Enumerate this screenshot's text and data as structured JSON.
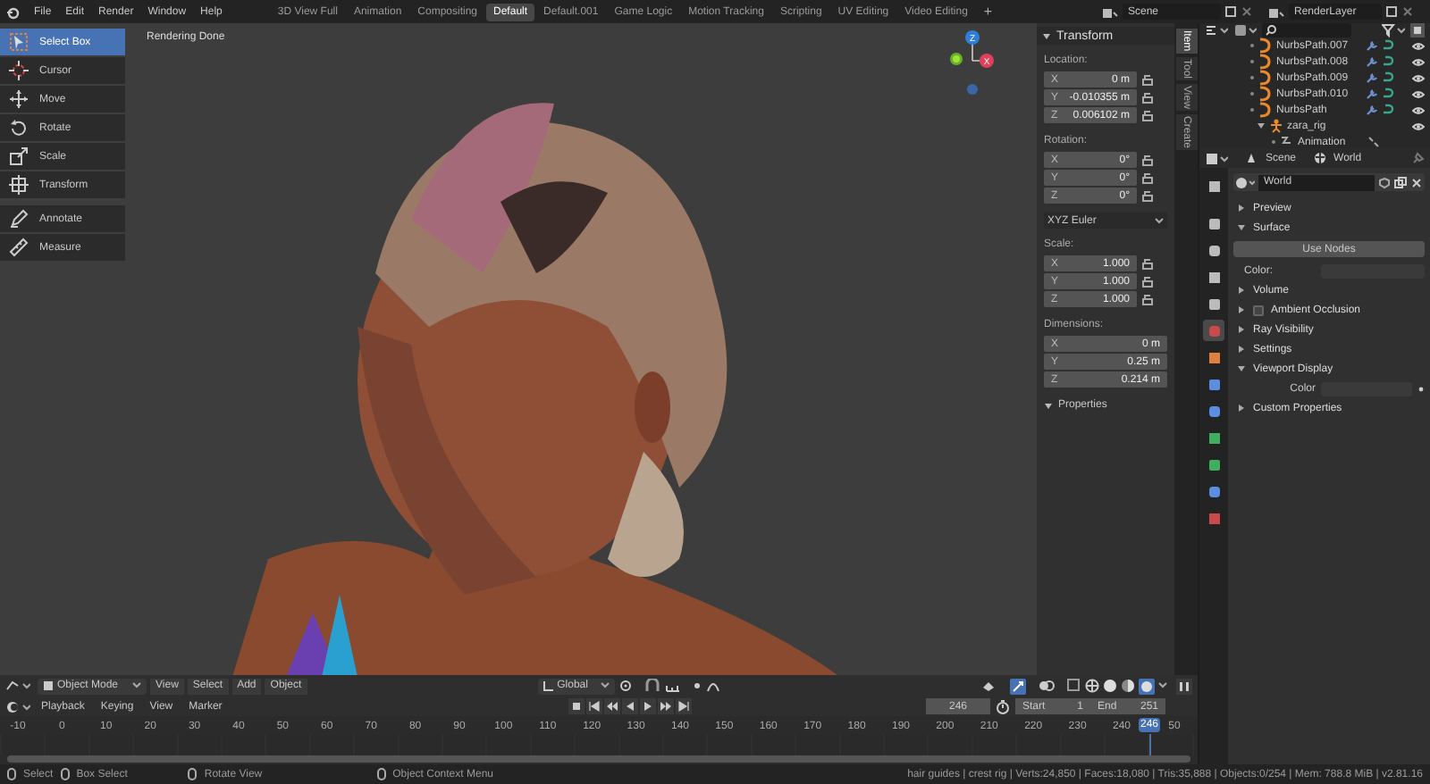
{
  "menu": [
    "File",
    "Edit",
    "Render",
    "Window",
    "Help"
  ],
  "workspaces": [
    {
      "label": "3D View Full",
      "selected": false
    },
    {
      "label": "Animation",
      "selected": false
    },
    {
      "label": "Compositing",
      "selected": false
    },
    {
      "label": "Default",
      "selected": true
    },
    {
      "label": "Default.001",
      "selected": false
    },
    {
      "label": "Game Logic",
      "selected": false
    },
    {
      "label": "Motion Tracking",
      "selected": false
    },
    {
      "label": "Scripting",
      "selected": false
    },
    {
      "label": "UV Editing",
      "selected": false
    },
    {
      "label": "Video Editing",
      "selected": false
    }
  ],
  "add_workspace": "+",
  "scene": "Scene",
  "view_layer": "RenderLayer",
  "tools": [
    {
      "label": "Select Box",
      "selected": true
    },
    {
      "label": "Cursor",
      "selected": false
    },
    {
      "label": "Move",
      "selected": false
    },
    {
      "label": "Rotate",
      "selected": false
    },
    {
      "label": "Scale",
      "selected": false
    },
    {
      "label": "Transform",
      "selected": false
    },
    {
      "label": "Annotate",
      "selected": false
    },
    {
      "label": "Measure",
      "selected": false
    }
  ],
  "viewport_message": "Rendering Done",
  "gizmo": {
    "z": "Z",
    "x": "X"
  },
  "sidebar_tabs": [
    {
      "label": "Item",
      "selected": true
    },
    {
      "label": "Tool",
      "selected": false
    },
    {
      "label": "View",
      "selected": false
    },
    {
      "label": "Create",
      "selected": false
    }
  ],
  "transform": {
    "title": "Transform",
    "groups": [
      {
        "label": "Location:",
        "locks": true,
        "fields": [
          {
            "axis": "X",
            "value": "0 m"
          },
          {
            "axis": "Y",
            "value": "-0.010355 m"
          },
          {
            "axis": "Z",
            "value": "0.006102 m"
          }
        ]
      },
      {
        "label": "Rotation:",
        "locks": true,
        "fields": [
          {
            "axis": "X",
            "value": "0°"
          },
          {
            "axis": "Y",
            "value": "0°"
          },
          {
            "axis": "Z",
            "value": "0°"
          }
        ]
      },
      {
        "label": "Scale:",
        "locks": true,
        "fields": [
          {
            "axis": "X",
            "value": "1.000"
          },
          {
            "axis": "Y",
            "value": "1.000"
          },
          {
            "axis": "Z",
            "value": "1.000"
          }
        ]
      },
      {
        "label": "Dimensions:",
        "locks": false,
        "fields": [
          {
            "axis": "X",
            "value": "0 m"
          },
          {
            "axis": "Y",
            "value": "0.25 m"
          },
          {
            "axis": "Z",
            "value": "0.214 m"
          }
        ]
      }
    ],
    "rotation_mode": "XYZ Euler",
    "properties_panel": "Properties"
  },
  "header_3d": {
    "mode": "Object Mode",
    "menus": [
      "View",
      "Select",
      "Add",
      "Object"
    ],
    "orientation": "Global"
  },
  "outliner": {
    "items": [
      {
        "name": "NurbsPath.007",
        "kind": "curve"
      },
      {
        "name": "NurbsPath.008",
        "kind": "curve"
      },
      {
        "name": "NurbsPath.009",
        "kind": "curve"
      },
      {
        "name": "NurbsPath.010",
        "kind": "curve"
      },
      {
        "name": "NurbsPath",
        "kind": "curve"
      },
      {
        "name": "zara_rig",
        "kind": "armature",
        "expanded": true,
        "children": [
          {
            "name": "Animation",
            "kind": "action"
          }
        ]
      }
    ]
  },
  "properties": {
    "path": [
      "Scene",
      "World"
    ],
    "datablock": "World",
    "tabs": [
      {
        "selected": false
      },
      {
        "selected": false
      },
      {
        "selected": false
      },
      {
        "selected": false
      },
      {
        "selected": false
      },
      {
        "selected": true
      },
      {
        "selected": false
      },
      {
        "selected": false
      },
      {
        "selected": false
      },
      {
        "selected": false
      },
      {
        "selected": false
      },
      {
        "selected": false
      },
      {
        "selected": false
      }
    ],
    "rows": [
      {
        "kind": "panel",
        "label": "Preview",
        "expanded": false
      },
      {
        "kind": "panel",
        "label": "Surface",
        "expanded": true
      },
      {
        "kind": "button",
        "label": "Use Nodes"
      },
      {
        "kind": "color",
        "label": "Color:"
      },
      {
        "kind": "panel",
        "label": "Volume",
        "expanded": false
      },
      {
        "kind": "check_panel",
        "label": "Ambient Occlusion",
        "checked": false
      },
      {
        "kind": "panel",
        "label": "Ray Visibility",
        "expanded": false
      },
      {
        "kind": "panel",
        "label": "Settings",
        "expanded": false
      },
      {
        "kind": "panel",
        "label": "Viewport Display",
        "expanded": true
      },
      {
        "kind": "color",
        "label": "Color"
      },
      {
        "kind": "panel",
        "label": "Custom Properties",
        "expanded": false
      }
    ]
  },
  "timeline": {
    "menus": [
      "Playback",
      "Keying",
      "View",
      "Marker"
    ],
    "current_frame": "246",
    "start_label": "Start",
    "start": "1",
    "end_label": "End",
    "end": "251",
    "ticks": [
      "-10",
      "0",
      "10",
      "20",
      "30",
      "40",
      "50",
      "60",
      "70",
      "80",
      "90",
      "100",
      "110",
      "120",
      "130",
      "140",
      "150",
      "160",
      "170",
      "180",
      "190",
      "200",
      "210",
      "220",
      "230",
      "240",
      "50"
    ],
    "playhead_frame": "246"
  },
  "status": {
    "hints": [
      "Select",
      "Box Select",
      "Rotate View",
      "Object Context Menu"
    ],
    "stats": "hair guides | crest rig | Verts:24,850 | Faces:18,080 | Tris:35,888 | Objects:0/254 | Mem: 788.8 MiB | v2.81.16"
  }
}
